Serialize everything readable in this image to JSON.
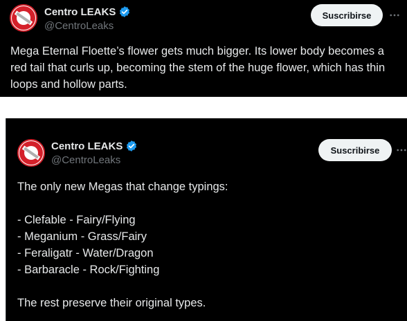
{
  "tweet1": {
    "display_name": "Centro LEAKS",
    "handle": "@CentroLeaks",
    "subscribe_label": "Suscribirse",
    "text_lines": [
      "Mega Eternal Floette’s flower gets much bigger. Its lower body becomes a",
      "red tail that curls up, becoming the stem of the huge flower, which has thin",
      "loops and hollow parts."
    ]
  },
  "tweet2": {
    "display_name": "Centro LEAKS",
    "handle": "@CentroLeaks",
    "subscribe_label": "Suscribirse",
    "text_lines": [
      "The only new Megas that change typings:",
      "",
      "- Clefable - Fairy/Flying",
      "- Meganium - Grass/Fairy",
      "- Feraligatr - Water/Dragon",
      "- Barbaracle - Rock/Fighting",
      "",
      "The rest preserve their original types."
    ]
  },
  "icons": {
    "verified": "verified-badge-icon",
    "more": "more-options-icon",
    "avatar": "centro-leaks-logo"
  },
  "colors": {
    "background": "#000000",
    "text": "#e7e9ea",
    "secondary_text": "#71767b",
    "verified": "#1d9bf0",
    "button_bg": "#eff3f4",
    "logo_red": "#d4202a"
  }
}
